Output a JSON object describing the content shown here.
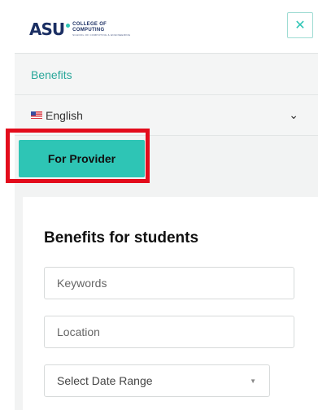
{
  "header": {
    "logo_mark": "ASU",
    "logo_line1": "COLLEGE OF",
    "logo_line2": "COMPUTING",
    "logo_line3": "SCHOOL OF COMPUTING & ENGINEERING",
    "close_glyph": "✕"
  },
  "menu": {
    "benefits_label": "Benefits",
    "language_label": "English",
    "language_chevron": "⌄"
  },
  "provider_button": {
    "label": "For Provider"
  },
  "card": {
    "title": "Benefits for students",
    "keywords_placeholder": "Keywords",
    "location_placeholder": "Location",
    "date_range_label": "Select Date Range",
    "date_range_caret": "▼"
  },
  "colors": {
    "accent": "#2ec5b5",
    "highlight": "#e30c1c",
    "brand_navy": "#1b2f63"
  },
  "icons": [
    "close-icon",
    "flag-us-icon",
    "chevron-down-icon",
    "caret-down-icon"
  ]
}
